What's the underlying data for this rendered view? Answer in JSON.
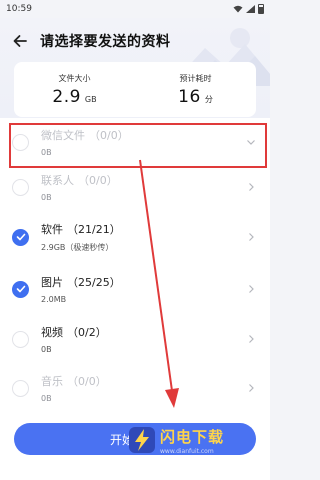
{
  "status_bar": {
    "time": "10:59"
  },
  "header": {
    "title": "请选择要发送的资料"
  },
  "summary": {
    "size_label": "文件大小",
    "size_value": "2.9",
    "size_unit": "GB",
    "time_label": "预计耗时",
    "time_value": "16",
    "time_unit": "分"
  },
  "items": [
    {
      "name": "微信文件",
      "count": "（0/0）",
      "sub": "0B",
      "checked": false,
      "disabled": true
    },
    {
      "name": "联系人",
      "count": "（0/0）",
      "sub": "0B",
      "checked": false,
      "disabled": true
    },
    {
      "name": "软件",
      "count": "（21/21）",
      "sub": "2.9GB（极速秒传）",
      "checked": true,
      "disabled": false
    },
    {
      "name": "图片",
      "count": "（25/25）",
      "sub": "2.0MB",
      "checked": true,
      "disabled": false
    },
    {
      "name": "视频",
      "count": "（0/2）",
      "sub": "0B",
      "checked": false,
      "disabled": false
    },
    {
      "name": "音乐",
      "count": "（0/0）",
      "sub": "0B",
      "checked": false,
      "disabled": true
    }
  ],
  "footer": {
    "start_label": "开始"
  },
  "watermark": {
    "text": "闪电下载",
    "url": "www.dianfuit.com"
  },
  "colors": {
    "accent": "#4a72f2",
    "highlight": "#e03a3a",
    "watermark": "#ffd44a"
  }
}
